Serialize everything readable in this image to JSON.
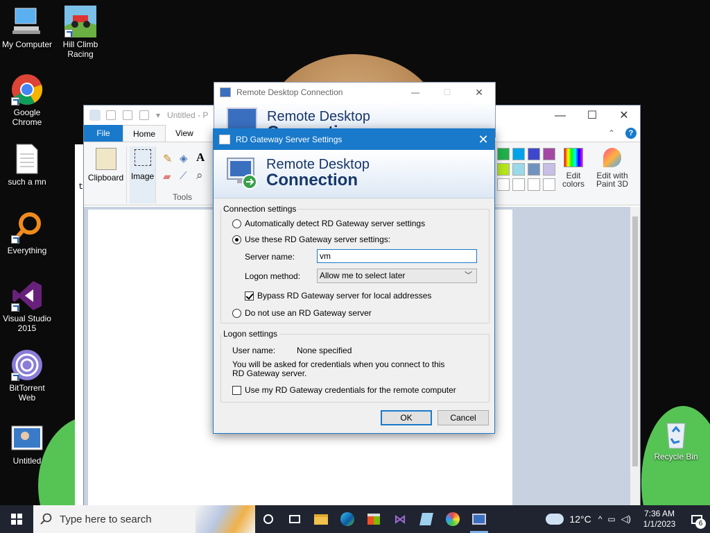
{
  "desktop": {
    "icons": [
      {
        "label": "My Computer"
      },
      {
        "label": "Hill Climb Racing"
      },
      {
        "label": "Google Chrome"
      },
      {
        "label": "such a mn"
      },
      {
        "label": "Everything"
      },
      {
        "label": "Visual Studio 2015"
      },
      {
        "label": "BitTorrent Web"
      },
      {
        "label": "Untitled"
      },
      {
        "label": "Recycle Bin"
      }
    ]
  },
  "paint": {
    "title": "Untitled - P",
    "tabs": {
      "file": "File",
      "home": "Home",
      "view": "View"
    },
    "groups": {
      "clipboard": "Clipboard",
      "image": "Image",
      "tools": "Tools",
      "edit_colors": "Edit colors",
      "edit_paint3d": "Edit with Paint 3D"
    },
    "left_text": "t"
  },
  "rdc": {
    "title": "Remote Desktop Connection",
    "banner_l1": "Remote Desktop",
    "banner_l2": "Connection"
  },
  "dialog": {
    "title": "RD Gateway Server Settings",
    "banner_l1": "Remote Desktop",
    "banner_l2": "Connection",
    "connection_settings": {
      "legend": "Connection settings",
      "auto_detect": "Automatically detect RD Gateway server settings",
      "use_these": "Use these RD Gateway server settings:",
      "server_name_label": "Server name:",
      "server_name_value": "vm",
      "logon_method_label": "Logon method:",
      "logon_method_value": "Allow me to select later",
      "bypass": "Bypass RD Gateway server for local addresses",
      "do_not_use": "Do not use an RD Gateway server"
    },
    "logon_settings": {
      "legend": "Logon settings",
      "user_name_label": "User name:",
      "user_name_value": "None specified",
      "note": "You will be asked for credentials when you connect to this RD Gateway server.",
      "use_credentials": "Use my RD Gateway credentials for the remote computer"
    },
    "ok": "OK",
    "cancel": "Cancel"
  },
  "taskbar": {
    "search_placeholder": "Type here to search",
    "temperature": "12°C",
    "time": "7:36 AM",
    "date": "1/1/2023",
    "notification_count": "6"
  },
  "colors": {
    "accent": "#1979ca",
    "taskbar": "#1f2430",
    "desktop": "#0b0b0b"
  }
}
